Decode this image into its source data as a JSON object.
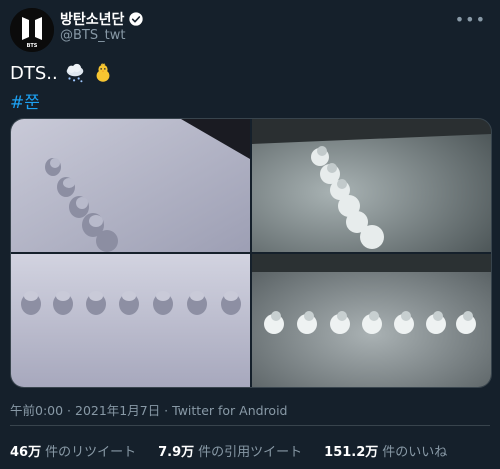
{
  "author": {
    "name": "방탄소년단",
    "handle": "@BTS_twt"
  },
  "tweet": {
    "text": "DTS..",
    "hashtag": "#쭌",
    "emojis": [
      "cloud-with-snow-icon",
      "baby-chick-icon"
    ]
  },
  "meta": {
    "text": "午前0:00 · 2021年1月7日 · Twitter for Android"
  },
  "stats": {
    "retweets_value": "46万",
    "retweets_label": "件のリツイート",
    "quotes_value": "7.9万",
    "quotes_label": "件の引用ツイート",
    "likes_value": "151.2万",
    "likes_label": "件のいいね"
  },
  "colors": {
    "background": "#15202b",
    "link": "#1da1f2",
    "secondary_text": "#8899a6",
    "verified": "#ffffff"
  }
}
